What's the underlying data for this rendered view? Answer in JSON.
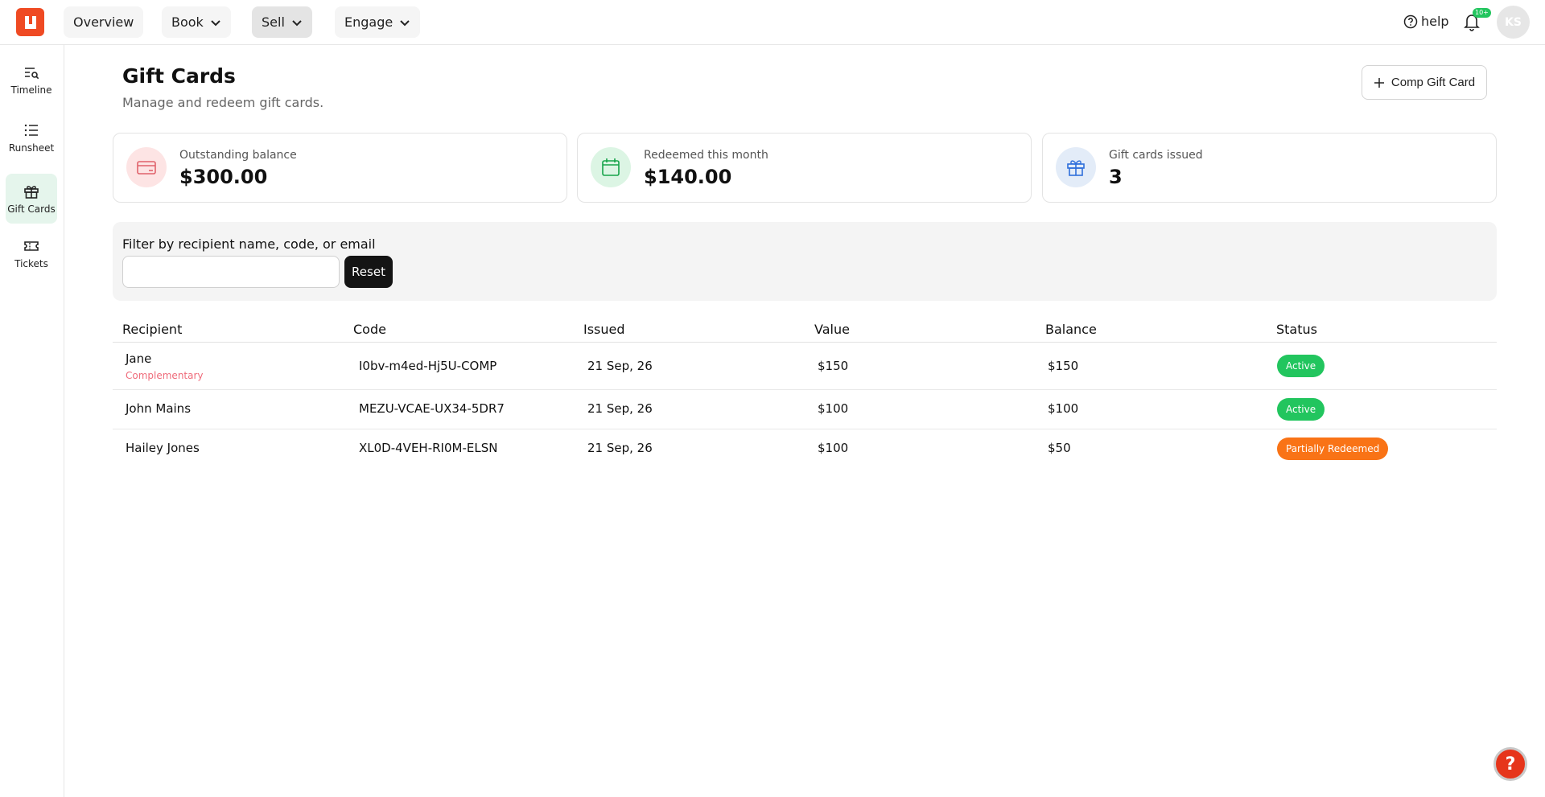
{
  "topnav": {
    "overview": "Overview",
    "book": "Book",
    "sell": "Sell",
    "engage": "Engage",
    "help": "help",
    "notif_badge": "10+",
    "avatar_initials": "KS"
  },
  "sidebar": {
    "items": [
      {
        "label": "Timeline",
        "icon": "timeline-icon"
      },
      {
        "label": "Runsheet",
        "icon": "list-icon"
      },
      {
        "label": "Gift Cards",
        "icon": "gift-icon"
      },
      {
        "label": "Tickets",
        "icon": "ticket-icon"
      }
    ]
  },
  "header": {
    "title": "Gift Cards",
    "subtitle": "Manage and redeem gift cards.",
    "comp_button": "Comp Gift Card"
  },
  "stats": [
    {
      "label": "Outstanding balance",
      "value": "$300.00",
      "icon": "credit-card-icon",
      "color": "#e0626b",
      "bg": "#fde4e4"
    },
    {
      "label": "Redeemed this month",
      "value": "$140.00",
      "icon": "calendar-icon",
      "color": "#16a34a",
      "bg": "#dcf5e4"
    },
    {
      "label": "Gift cards issued",
      "value": "3",
      "icon": "gift-icon",
      "color": "#2f6fdb",
      "bg": "#e3ecf8"
    }
  ],
  "filter": {
    "label": "Filter by recipient name, code, or email",
    "value": "",
    "reset": "Reset"
  },
  "table": {
    "headers": [
      "Recipient",
      "Code",
      "Issued",
      "Value",
      "Balance",
      "Status"
    ],
    "rows": [
      {
        "recipient": "Jane",
        "note": "Complementary",
        "code": "I0bv-m4ed-Hj5U-COMP",
        "issued": "21 Sep, 26",
        "value": "$150",
        "balance": "$150",
        "status": "Active",
        "status_color": "#22c55e"
      },
      {
        "recipient": "John Mains",
        "note": "",
        "code": "MEZU-VCAE-UX34-5DR7",
        "issued": "21 Sep, 26",
        "value": "$100",
        "balance": "$100",
        "status": "Active",
        "status_color": "#22c55e"
      },
      {
        "recipient": "Hailey Jones",
        "note": "",
        "code": "XL0D-4VEH-RI0M-ELSN",
        "issued": "21 Sep, 26",
        "value": "$100",
        "balance": "$50",
        "status": "Partially Redeemed",
        "status_color": "#f97316"
      }
    ]
  },
  "floating_help": "?"
}
